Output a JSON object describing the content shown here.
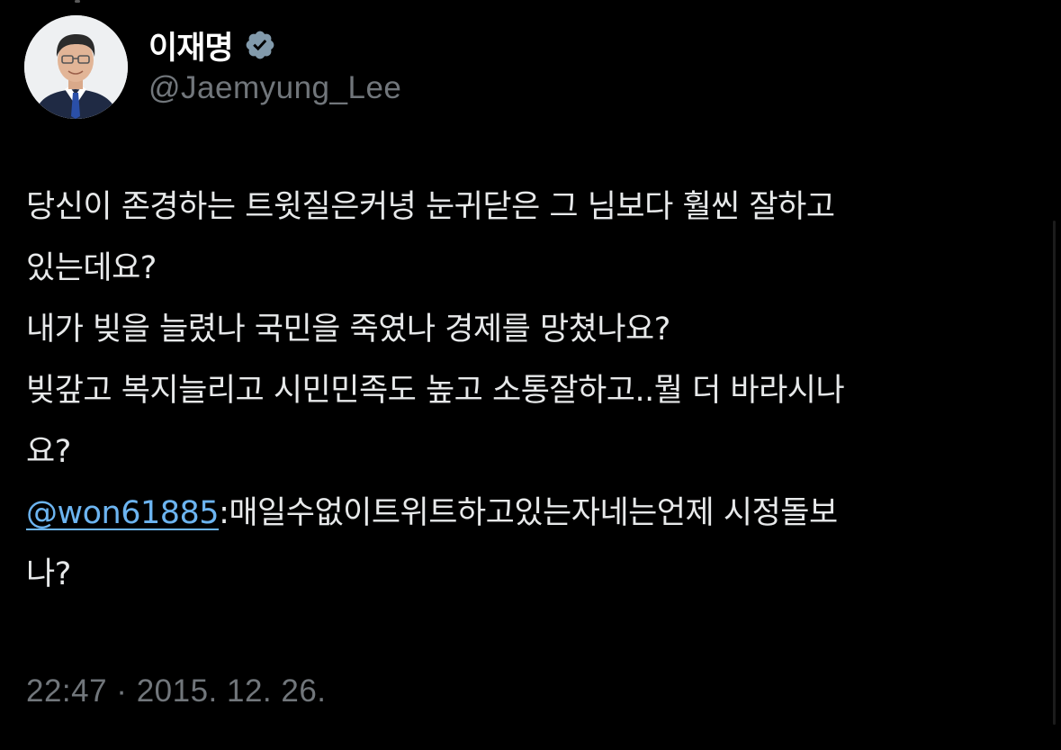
{
  "author": {
    "display_name": "이재명",
    "handle": "@Jaemyung_Lee",
    "verified_icon": "verified-badge-icon",
    "avatar_icon": "profile-photo-icon"
  },
  "tweet": {
    "lines": [
      "당신이 존경하는 트윗질은커녕 눈귀닫은 그 님보다 훨씬 잘하고",
      "있는데요?",
      "내가 빚을 늘렸나 국민을 죽였나 경제를 망쳤나요?",
      "빚갚고 복지늘리고 시민민족도 높고 소통잘하고..뭘 더 바라시나",
      "요?"
    ],
    "mention": "@won61885",
    "quote_line1_rest": ":매일수없이트위트하고있는자네는언제 시정돌보",
    "quote_line2": "나?"
  },
  "meta": {
    "timestamp": "22:47 · 2015. 12. 26."
  },
  "colors": {
    "background": "#000000",
    "text": "#e7e9ea",
    "secondary": "#71767b",
    "link": "#6cb4f0",
    "verified": "#829aab"
  }
}
